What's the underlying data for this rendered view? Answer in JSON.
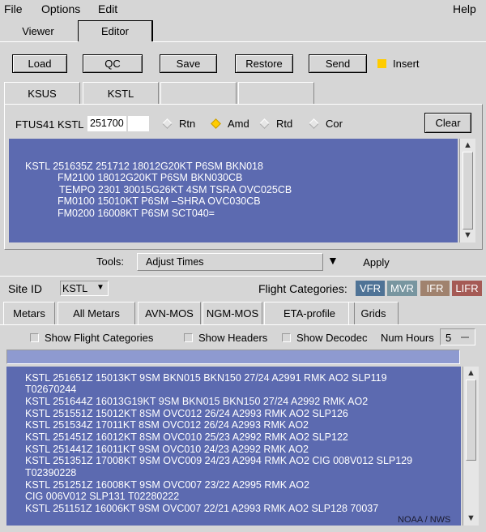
{
  "menu": {
    "file": "File",
    "options": "Options",
    "edit": "Edit",
    "help": "Help"
  },
  "top_tabs": {
    "viewer": "Viewer",
    "editor": "Editor"
  },
  "toolbar": {
    "load": "Load",
    "qc": "QC",
    "save": "Save",
    "restore": "Restore",
    "send": "Send",
    "insert": "Insert",
    "insert_color": "#ffcc00"
  },
  "site_tabs": {
    "ksus": "KSUS",
    "kstl": "KSTL"
  },
  "header": {
    "label": "FTUS41 KSTL",
    "time_value": "251700",
    "second_value": "",
    "radios": [
      "Rtn",
      "Amd",
      "Rtd",
      "Cor"
    ],
    "selected_radio": "Amd",
    "clear": "Clear"
  },
  "taf": {
    "lines": [
      "KSTL 251635Z 251712 18012G20KT P6SM BKN018",
      "FM2100 18012G20KT P6SM BKN030CB",
      "TEMPO 2301 30015G26KT 4SM TSRA OVC025CB",
      "FM0100 15010KT P6SM –SHRA OVC030CB",
      "FM0200 16008KT P6SM SCT040="
    ]
  },
  "tools": {
    "label": "Tools:",
    "selected": "Adjust Times",
    "apply": "Apply"
  },
  "site_id": {
    "label": "Site ID",
    "value": "KSTL"
  },
  "flight_categories": {
    "label": "Flight Categories:",
    "items": [
      {
        "name": "VFR",
        "color": "#4f7396"
      },
      {
        "name": "MVR",
        "color": "#7896a0"
      },
      {
        "name": "IFR",
        "color": "#a0826e"
      },
      {
        "name": "LIFR",
        "color": "#a55a55"
      }
    ]
  },
  "data_tabs": [
    "Metars",
    "All Metars",
    "AVN-MOS",
    "NGM-MOS",
    "ETA-profile",
    "Grids"
  ],
  "options": {
    "show_flight_categories": "Show Flight Categories",
    "show_headers": "Show Headers",
    "show_decoded": "Show Decodec",
    "num_hours_label": "Num Hours",
    "num_hours_value": "5"
  },
  "metars": {
    "lines": [
      "KSTL 251651Z 15013KT 9SM BKN015 BKN150 27/24 A2991 RMK AO2 SLP119",
      "T02670244",
      "KSTL 251644Z 16013G19KT 9SM BKN015 BKN150 27/24 A2992 RMK AO2",
      "KSTL 251551Z 15012KT 8SM OVC012 26/24 A2993 RMK AO2 SLP126",
      "KSTL 251534Z 17011KT 8SM OVC012 26/24 A2993 RMK AO2",
      "KSTL 251451Z 16012KT 8SM OVC010 25/23 A2992 RMK AO2 SLP122",
      "KSTL 251441Z 16011KT 9SM OVC010 24/23 A2992 RMK AO2",
      "KSTL 251351Z 17008KT 9SM OVC009 24/23 A2994 RMK AO2 CIG 008V012 SLP129",
      "T02390228",
      "KSTL 251251Z 16008KT 9SM OVC007 23/22 A2995 RMK AO2",
      "CIG 006V012 SLP131 T02280222",
      "KSTL 251151Z 16006KT 9SM OVC007 22/21 A2993 RMK AO2 SLP128 70037"
    ]
  },
  "watermark": "NOAA / NWS",
  "colors": {
    "text_panel": "#5c6ab0",
    "background": "#d6d6d6"
  }
}
